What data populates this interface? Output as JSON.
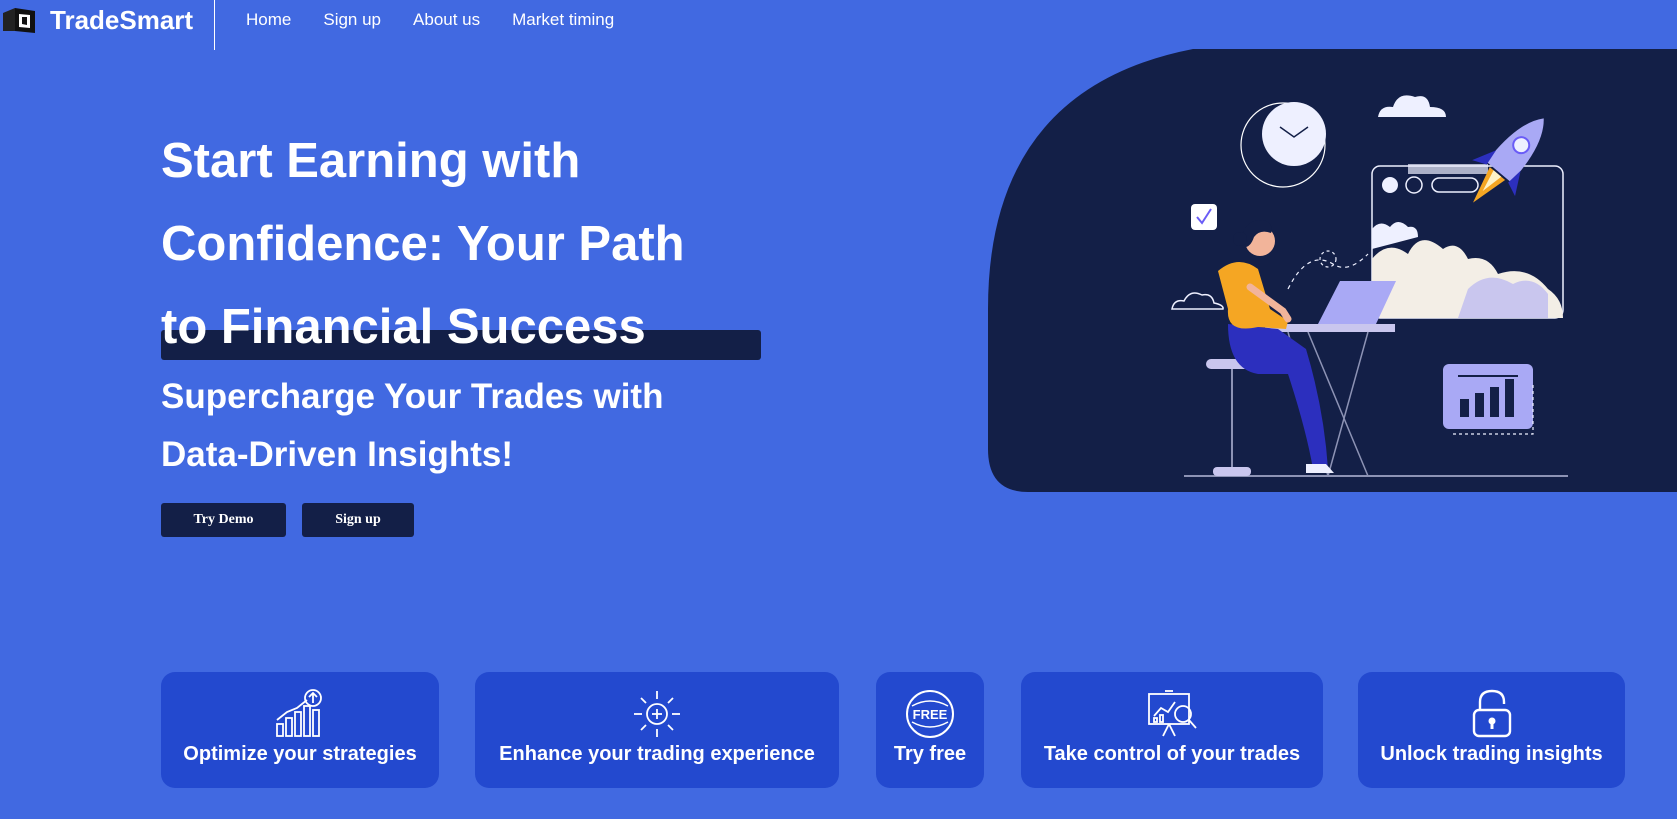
{
  "app": {
    "brand": "TradeSmart",
    "logo_icon": "cube-logo-icon"
  },
  "nav": {
    "items": [
      {
        "label": "Home"
      },
      {
        "label": "Sign up"
      },
      {
        "label": "About us"
      },
      {
        "label": "Market timing"
      }
    ]
  },
  "hero": {
    "title_lines": [
      "Start Earning with",
      "Confidence: Your Path",
      "to Financial Success"
    ],
    "subtitle_lines": [
      "Supercharge Your Trades with",
      "Data-Driven Insights!"
    ],
    "buttons": {
      "demo": "Try Demo",
      "signup": "Sign up"
    },
    "illustration_icon": "woman-at-laptop-rocket-illustration"
  },
  "features": [
    {
      "label": "Optimize your strategies",
      "icon": "growth-chart-icon"
    },
    {
      "label": "Enhance your trading experience",
      "icon": "sparkle-plus-icon"
    },
    {
      "label": "Try free",
      "icon": "free-badge-icon"
    },
    {
      "label": "Take control of your trades",
      "icon": "analytics-board-icon"
    },
    {
      "label": "Unlock trading insights",
      "icon": "unlock-icon"
    }
  ],
  "colors": {
    "background": "#4169e1",
    "navy": "#131f47",
    "card": "#2349cf",
    "accent_orange": "#f5a623",
    "accent_lavender": "#a9a9f5"
  }
}
